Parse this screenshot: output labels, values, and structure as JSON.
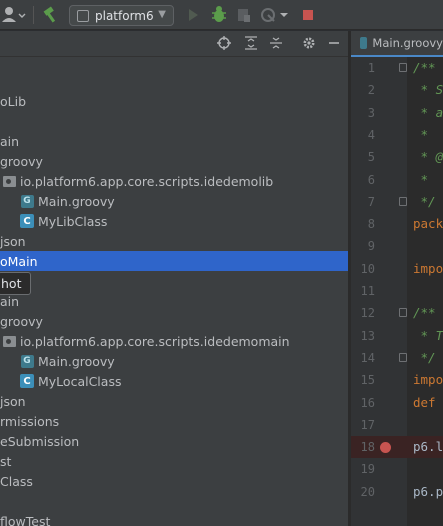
{
  "toolbar": {
    "run_config_label": "platform6",
    "colors": {
      "build": "#5b9c4b",
      "run": "#505a50",
      "debug": "#5b9c4b",
      "stop": "#c75450"
    }
  },
  "project_pane": {
    "tree": [
      {
        "label": "oLib",
        "kind": "module",
        "selected": false
      },
      {
        "label": "ain",
        "kind": "folder",
        "selected": false
      },
      {
        "label": "groovy",
        "kind": "folder",
        "selected": false
      },
      {
        "label": "io.platform6.app.core.scripts.idedemolib",
        "kind": "package",
        "selected": false
      },
      {
        "label": "Main.groovy",
        "kind": "groovy-file",
        "selected": false
      },
      {
        "label": "MyLibClass",
        "kind": "class",
        "selected": false
      },
      {
        "label": "json",
        "kind": "file",
        "selected": false
      },
      {
        "label": "oMain",
        "kind": "module",
        "selected": true
      },
      {
        "label": "ain",
        "kind": "folder",
        "selected": false
      },
      {
        "label": "groovy",
        "kind": "folder",
        "selected": false
      },
      {
        "label": "io.platform6.app.core.scripts.idedemomain",
        "kind": "package",
        "selected": false
      },
      {
        "label": "Main.groovy",
        "kind": "groovy-file",
        "selected": false
      },
      {
        "label": "MyLocalClass",
        "kind": "class",
        "selected": false
      },
      {
        "label": "json",
        "kind": "file",
        "selected": false
      },
      {
        "label": "rmissions",
        "kind": "item",
        "selected": false
      },
      {
        "label": "eSubmission",
        "kind": "item",
        "selected": false
      },
      {
        "label": "st",
        "kind": "item",
        "selected": false
      },
      {
        "label": "Class",
        "kind": "item",
        "selected": false
      },
      {
        "label": "flowTest",
        "kind": "item",
        "selected": false
      }
    ],
    "tooltip": "hot"
  },
  "editor": {
    "tab_label": "Main.groovy",
    "lines": [
      {
        "n": "1",
        "text": "/**",
        "style": "comment"
      },
      {
        "n": "2",
        "text": " * S",
        "style": "comment"
      },
      {
        "n": "3",
        "text": " * a",
        "style": "comment"
      },
      {
        "n": "4",
        "text": " *",
        "style": "comment"
      },
      {
        "n": "5",
        "text": " * @",
        "style": "comment"
      },
      {
        "n": "6",
        "text": " *",
        "style": "comment"
      },
      {
        "n": "7",
        "text": " */",
        "style": "comment"
      },
      {
        "n": "8",
        "text": "pack",
        "style": "kw"
      },
      {
        "n": "9",
        "text": "",
        "style": "plain"
      },
      {
        "n": "10",
        "text": "impo",
        "style": "kw"
      },
      {
        "n": "11",
        "text": "",
        "style": "plain"
      },
      {
        "n": "12",
        "text": "/**",
        "style": "comment"
      },
      {
        "n": "13",
        "text": " * T",
        "style": "comment"
      },
      {
        "n": "14",
        "text": " */",
        "style": "comment"
      },
      {
        "n": "15",
        "text": "impo",
        "style": "kw"
      },
      {
        "n": "16",
        "text": "def",
        "style": "kw"
      },
      {
        "n": "17",
        "text": "",
        "style": "plain"
      },
      {
        "n": "18",
        "text": "p6.l",
        "style": "field"
      },
      {
        "n": "19",
        "text": "",
        "style": "plain"
      },
      {
        "n": "20",
        "text": "p6.p",
        "style": "field"
      }
    ],
    "breakpoint_line": "18"
  }
}
